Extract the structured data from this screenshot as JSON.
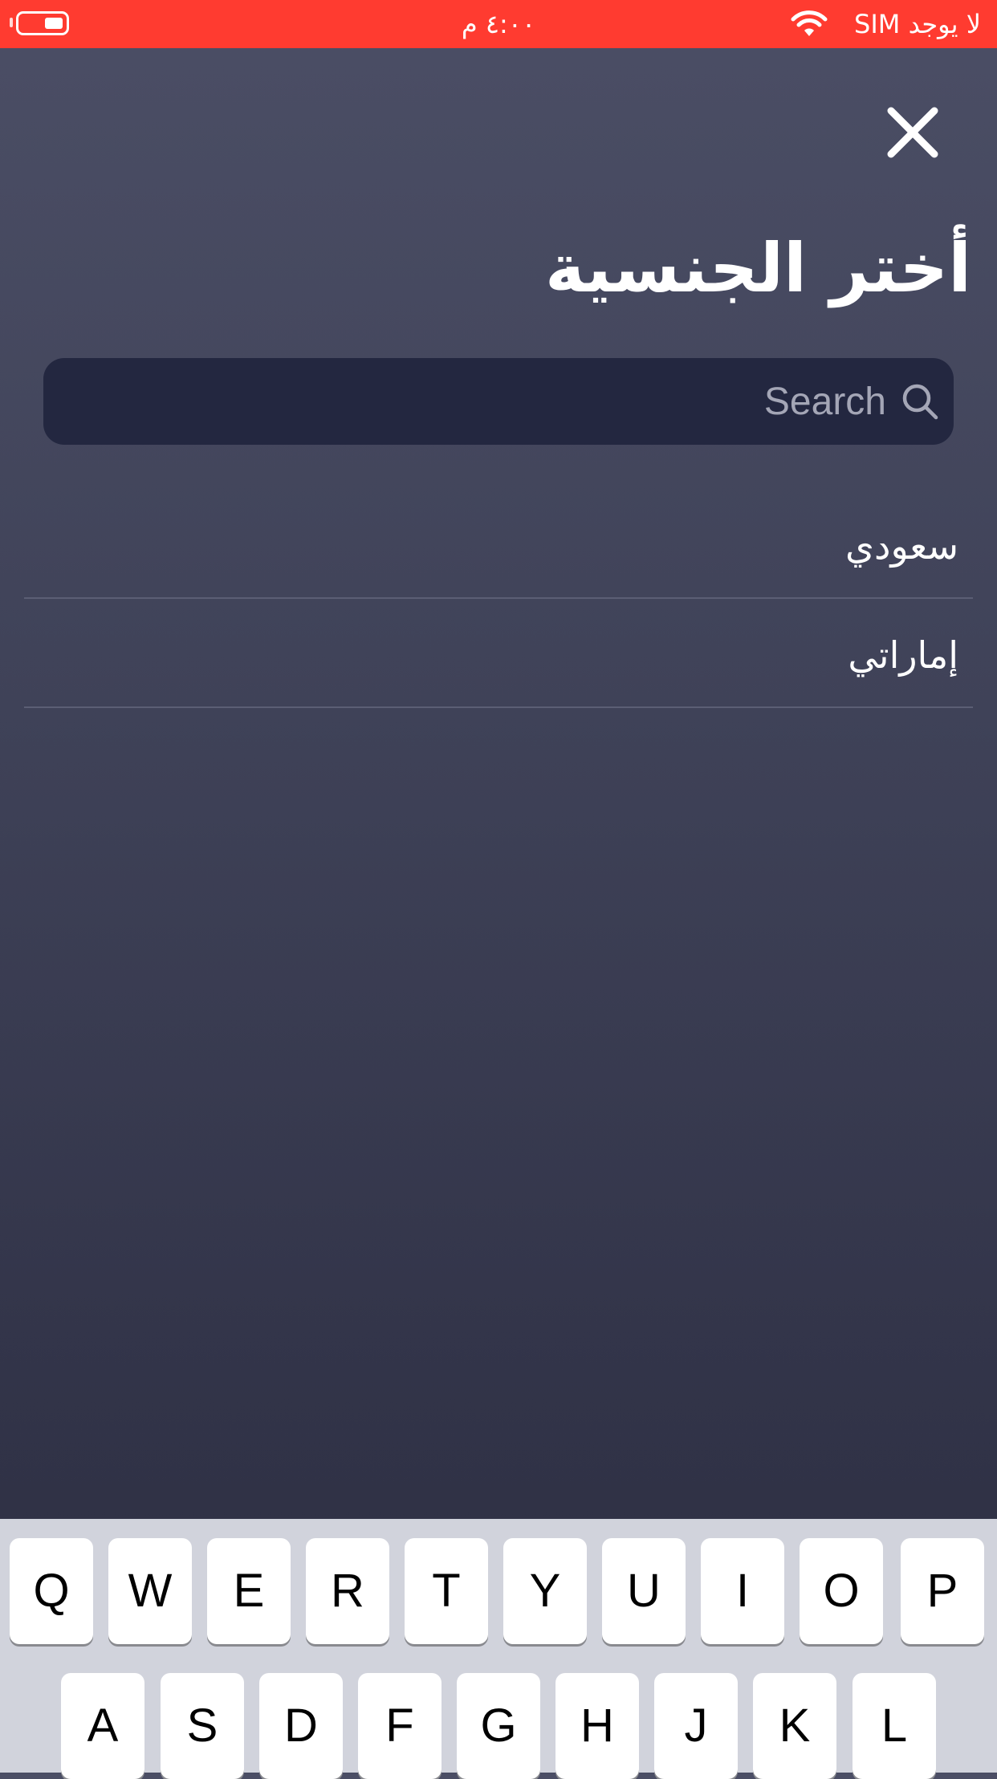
{
  "status_bar": {
    "time": "٤:٠٠ م",
    "carrier": "لا يوجد SIM",
    "battery_icon": "battery-icon",
    "wifi_icon": "wifi-icon",
    "background_color": "#ff3b30"
  },
  "header": {
    "close_icon": "close-icon",
    "title": "أختر الجنسية"
  },
  "search": {
    "placeholder": "Search",
    "value": "",
    "icon": "search-icon"
  },
  "nationalities": [
    {
      "label": "سعودي"
    },
    {
      "label": "إماراتي"
    }
  ],
  "keyboard": {
    "row1": [
      "Q",
      "W",
      "E",
      "R",
      "T",
      "Y",
      "U",
      "I",
      "O",
      "P"
    ],
    "row2": [
      "A",
      "S",
      "D",
      "F",
      "G",
      "H",
      "J",
      "K",
      "L"
    ]
  }
}
